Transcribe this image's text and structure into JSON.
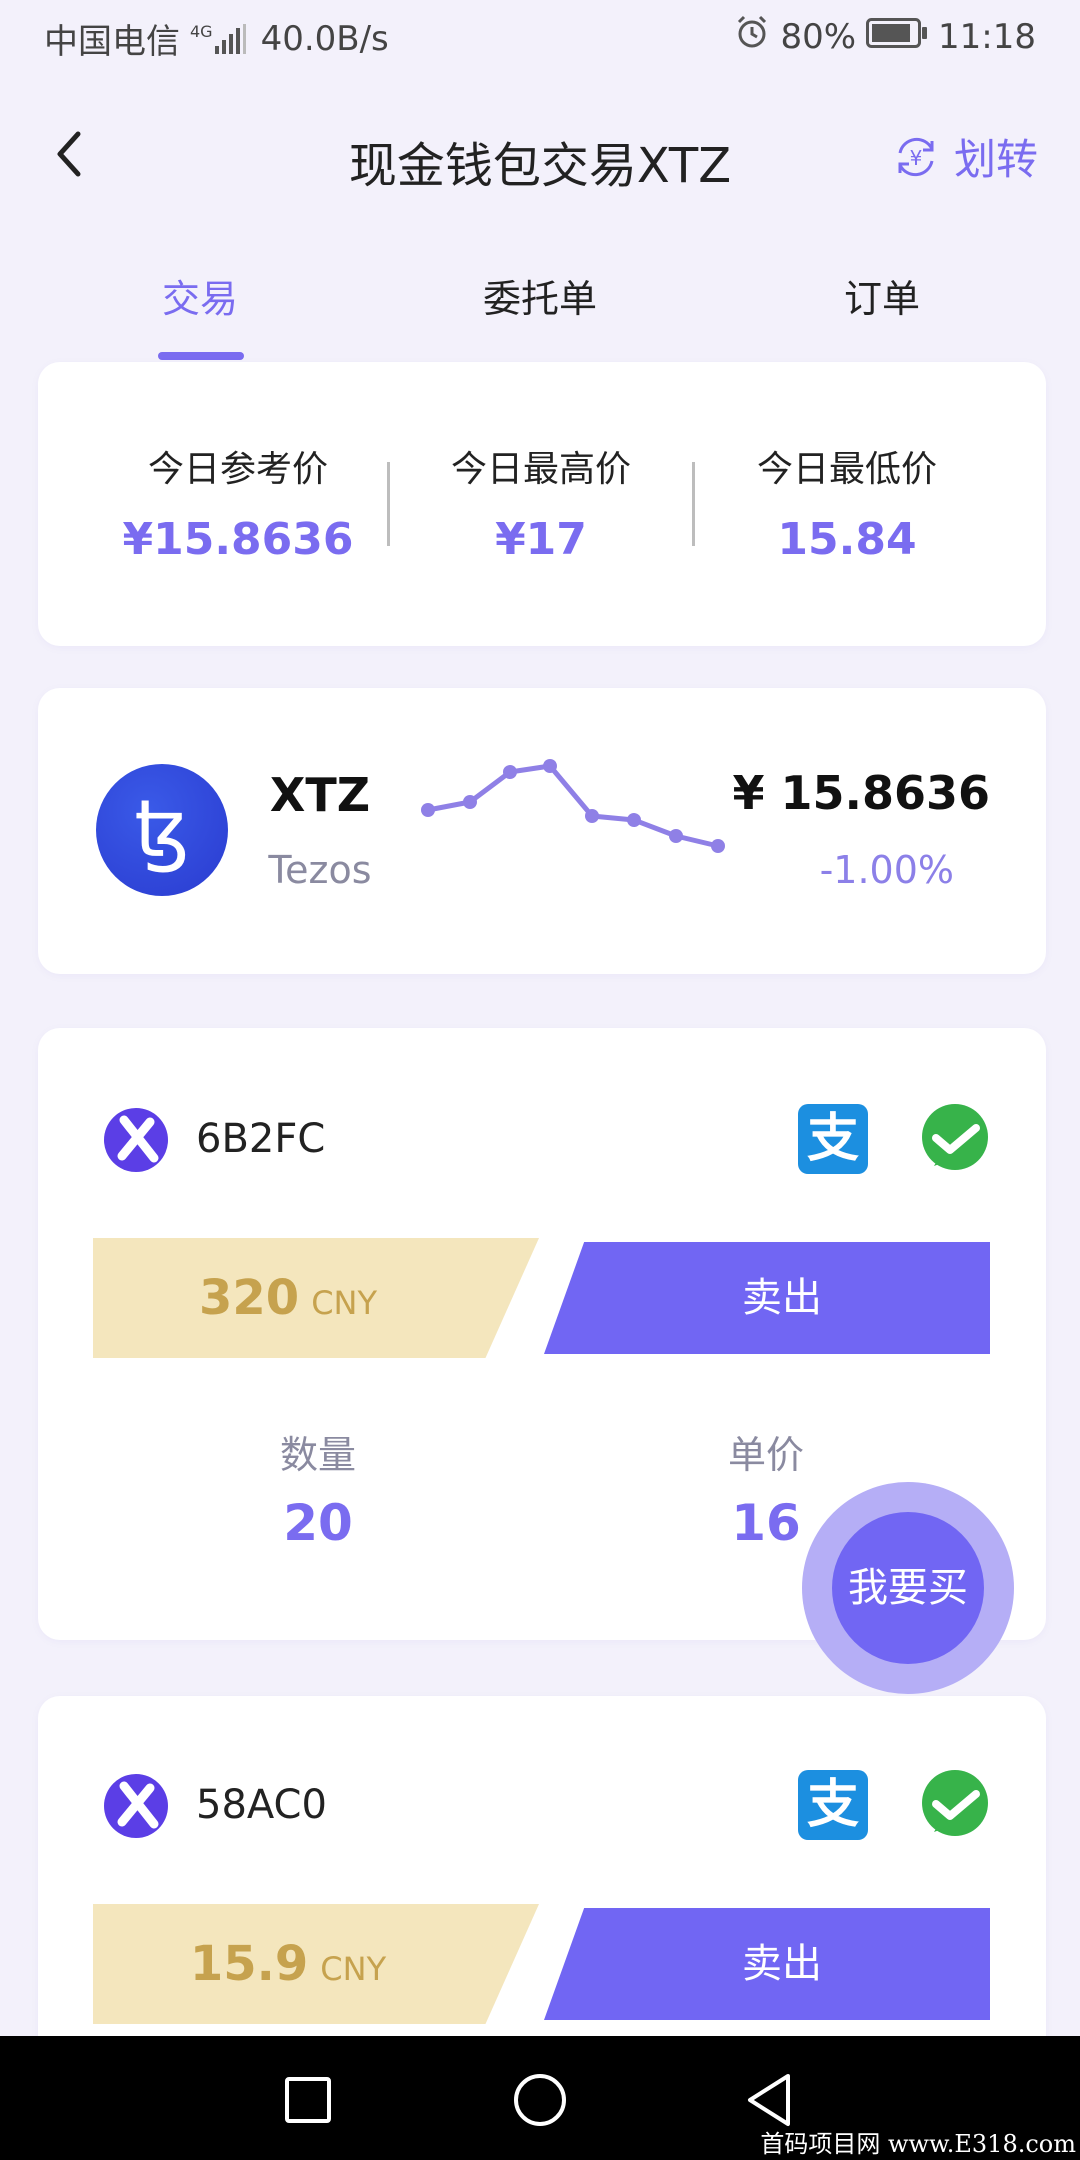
{
  "status_bar": {
    "carrier": "中国电信",
    "network": "4G",
    "speed": "40.0B/s",
    "battery": "80%",
    "time": "11:18"
  },
  "header": {
    "title": "现金钱包交易XTZ",
    "transfer_label": "划转",
    "transfer_icon_glyph": "¥"
  },
  "tabs": [
    {
      "label": "交易",
      "active": true
    },
    {
      "label": "委托单",
      "active": false
    },
    {
      "label": "订单",
      "active": false
    }
  ],
  "prices": [
    {
      "label": "今日参考价",
      "value": "¥15.8636"
    },
    {
      "label": "今日最高价",
      "value": "¥17"
    },
    {
      "label": "今日最低价",
      "value": "15.84"
    }
  ],
  "coin": {
    "symbol": "XTZ",
    "name": "Tezos",
    "logo_glyph": "ꜩ",
    "price": "¥ 15.8636",
    "change": "-1.00%"
  },
  "offers": [
    {
      "id": "6B2FC",
      "amount": "320",
      "currency": "CNY",
      "action": "卖出",
      "quantity_label": "数量",
      "quantity": "20",
      "unit_price_label": "单价",
      "unit_price": "16",
      "pay_ali_glyph": "支"
    },
    {
      "id": "58AC0",
      "amount": "15.9",
      "currency": "CNY",
      "action": "卖出",
      "pay_ali_glyph": "支"
    }
  ],
  "buy_button": "我要买",
  "colors": {
    "accent": "#7166f3",
    "accent_light": "#b5aef6",
    "amount_bg": "#f4e6bd",
    "amount_text": "#c6a24e",
    "background": "#f3f1fb"
  },
  "watermark": "首码项目网 www.E318.com"
}
